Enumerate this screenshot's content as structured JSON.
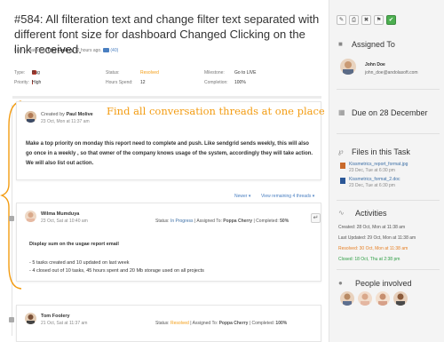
{
  "task": {
    "title": "#584: All filteration text and change filter text separated with different font size for dashboard Changed Clicking on the link received.",
    "updated_prefix": "Last updated by",
    "updated_by": "Tom Foolery",
    "updated_ago": "12 hours ago.",
    "updated_count": "(40)"
  },
  "meta": {
    "type_label": "Type:",
    "type_value": "Bug",
    "status_label": "Status:",
    "status_value": "Resolved",
    "milestone_label": "Milestone:",
    "milestone_value": "Go to LIVE",
    "priority_label": "Priority:",
    "priority_value": "High",
    "hours_label": "Hours Spend:",
    "hours_value": "12",
    "completion_label": "Completion:",
    "completion_value": "100%"
  },
  "callout": "Find all conversation threads at one place",
  "comments": [
    {
      "created_by_prefix": "Created by",
      "author": "Paul Molive",
      "date": "23 Oct, Mon at 11:37 am",
      "body": "Make a top priority on monday this report need to complete and push. Like sendgrid sends weekly, this will also go once in a weekly , so that owner of the company knows usage of the system, accordingly they will take action. We will also list out action."
    },
    {
      "author": "Wilma Mumduya",
      "date": "23 Oct, Sat at 10:40 am",
      "status_label": "Status:",
      "status_value": "In Progress",
      "assigned_label": "Assigned To:",
      "assigned_value": "Poppa Cherry",
      "completed_label": "Completed:",
      "completed_value": "50%",
      "headline": "Display sum on the usgae report email",
      "lines": [
        "- 5 tasks created and 10 updated on last week",
        "- 4 closed out of 10 tasks, 45 hours spent and 20 Mb storage used on all projects"
      ]
    },
    {
      "author": "Tom Foolery",
      "date": "21 Oct, Sat at 11:37 am",
      "status_label": "Status:",
      "status_value": "Resolved",
      "assigned_label": "Assigned To:",
      "assigned_value": "Poppa Cherry",
      "completed_label": "Completed:",
      "completed_value": "100%"
    }
  ],
  "thread_nav": {
    "newer": "Newer ▾",
    "view_remaining": "View remaining 4 threads ▾"
  },
  "sidebar": {
    "assigned_title": "Assigned To",
    "assignee_name": "John Doe",
    "assignee_email": "john_doe@andolasoft.com",
    "due": "Due on 28 December",
    "files_title": "Files in this Task",
    "files": [
      {
        "name": "Kissmetrics_report_format.jpg",
        "date": "23 Dec, Tue at 6:30 pm"
      },
      {
        "name": "Kissmetrics_format_2.doc",
        "date": "23 Dec, Tue at 6:30 pm"
      }
    ],
    "activities_title": "Activities",
    "activities": [
      {
        "text": "Created: 28 Oct, Mon at 11:38 am",
        "color": "#555555"
      },
      {
        "text": "Last Updated: 29 Oct, Mon at 11:38 am",
        "color": "#555555"
      },
      {
        "text": "Resolved: 30 Oct, Mon at 11:38 am",
        "color": "#e67e22"
      },
      {
        "text": "Closed: 18 Oct, Thu at 2:38 pm",
        "color": "#2e9e45"
      }
    ],
    "people_title": "People involved"
  },
  "toolbar_icons": [
    "edit-icon",
    "print-icon",
    "delete-icon",
    "tag-icon",
    "check-icon"
  ],
  "colors": {
    "accent_orange": "#f39c12",
    "link_blue": "#3b6ea5"
  }
}
